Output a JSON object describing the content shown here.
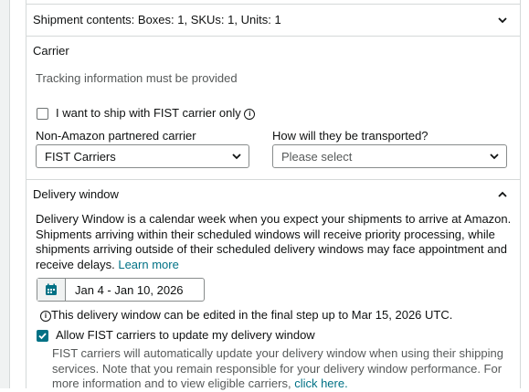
{
  "shipment_contents": {
    "label": "Shipment contents: Boxes: 1, SKUs: 1, Units: 1",
    "icon": "chevron-down-icon"
  },
  "carrier": {
    "heading": "Carrier",
    "tracking_note": "Tracking information must be provided",
    "fist_checkbox_label": "I want to ship with FIST carrier only",
    "fist_checkbox_checked": false,
    "non_amazon_label": "Non-Amazon partnered carrier",
    "non_amazon_value": "FIST Carriers",
    "transport_label": "How will they be transported?",
    "transport_value": "Please select"
  },
  "delivery_window": {
    "heading": "Delivery window",
    "icon": "chevron-up-icon",
    "description": "Delivery Window is a calendar week when you expect your shipments to arrive at Amazon. Shipments arriving within their scheduled windows will receive priority processing, while shipments arriving outside of their scheduled delivery windows may face appointment and receive delays.",
    "learn_more": "Learn more",
    "date_range": "Jan 4 - Jan 10, 2026",
    "edit_note": "This delivery window can be edited in the final step up to Mar 15, 2026 UTC.",
    "allow_fist_label": "Allow FIST carriers to update my delivery window",
    "allow_fist_checked": true,
    "fist_note": "FIST carriers will automatically update your delivery window when using their shipping services. Note that you remain responsible for your delivery window performance. For more information and to view eligible carriers,",
    "click_here": "click here."
  },
  "colors": {
    "link": "#007185",
    "border": "#d5d9d9",
    "check_fill": "#007185",
    "muted_text": "#565959"
  }
}
